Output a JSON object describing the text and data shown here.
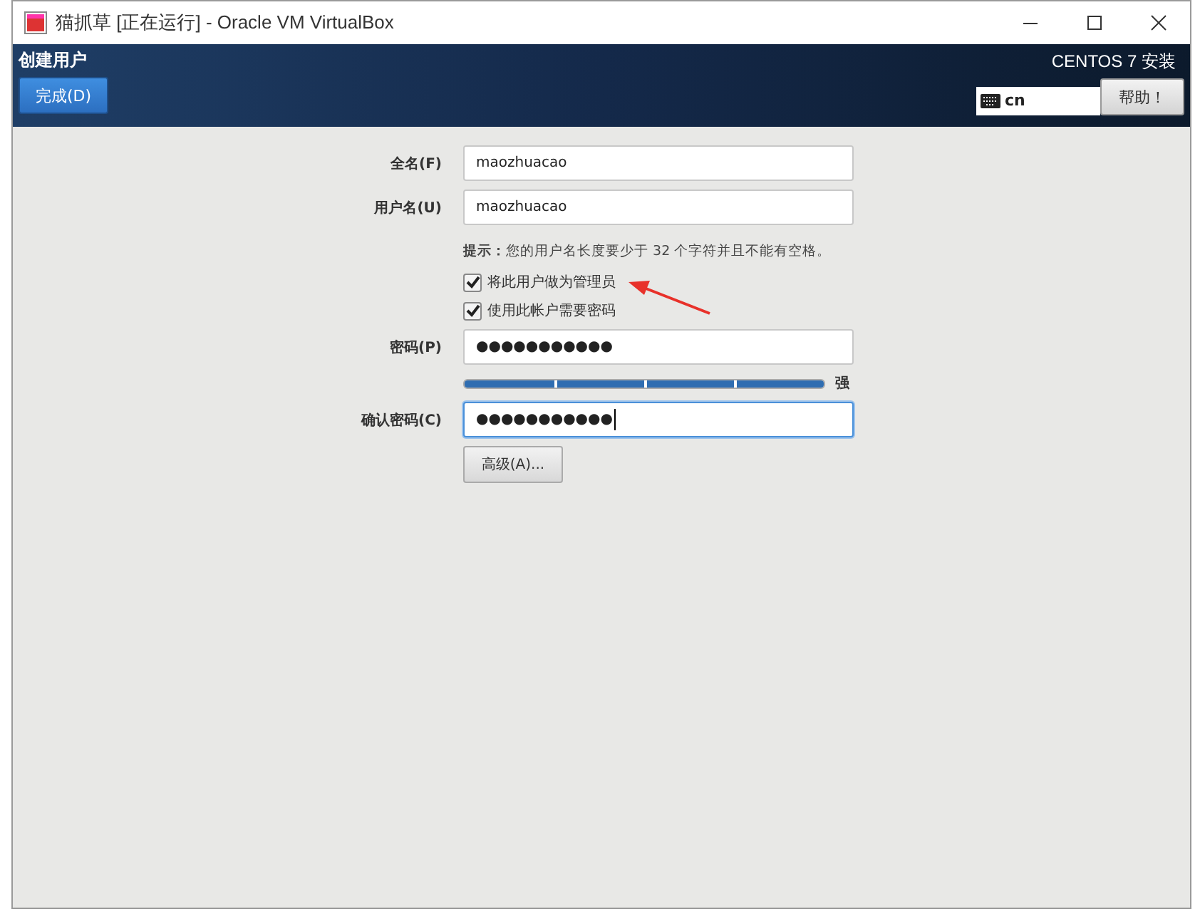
{
  "window": {
    "title": "猫抓草 [正在运行] - Oracle VM VirtualBox"
  },
  "header": {
    "title": "创建用户",
    "done_button": "完成(D)",
    "product": "CENTOS 7 安装",
    "keyboard_layout": "cn",
    "help_button": "帮助！"
  },
  "form": {
    "fields": [
      {
        "label": "全名(F)",
        "value": "maozhuacao",
        "focused": false
      },
      {
        "label": "用户名(U)",
        "value": "maozhuacao",
        "focused": false
      }
    ],
    "hint": "**提示：**您的用户名长度要少于 32 个字符并且不能有空格。",
    "checkboxes": [
      {
        "label": "将此用户做为管理员",
        "checked": true
      },
      {
        "label": "使用此帐户需要密码",
        "checked": true
      }
    ],
    "password": {
      "label": "密码(P)",
      "value": "●●●●●●●●●●●",
      "focused": false
    },
    "strength": {
      "level": 1.0,
      "reading": "强"
    },
    "confirm": {
      "label": "确认密码(C)",
      "value": "●●●●●●●●●●●",
      "focused": true
    },
    "advanced_button": "高级(A)..."
  }
}
